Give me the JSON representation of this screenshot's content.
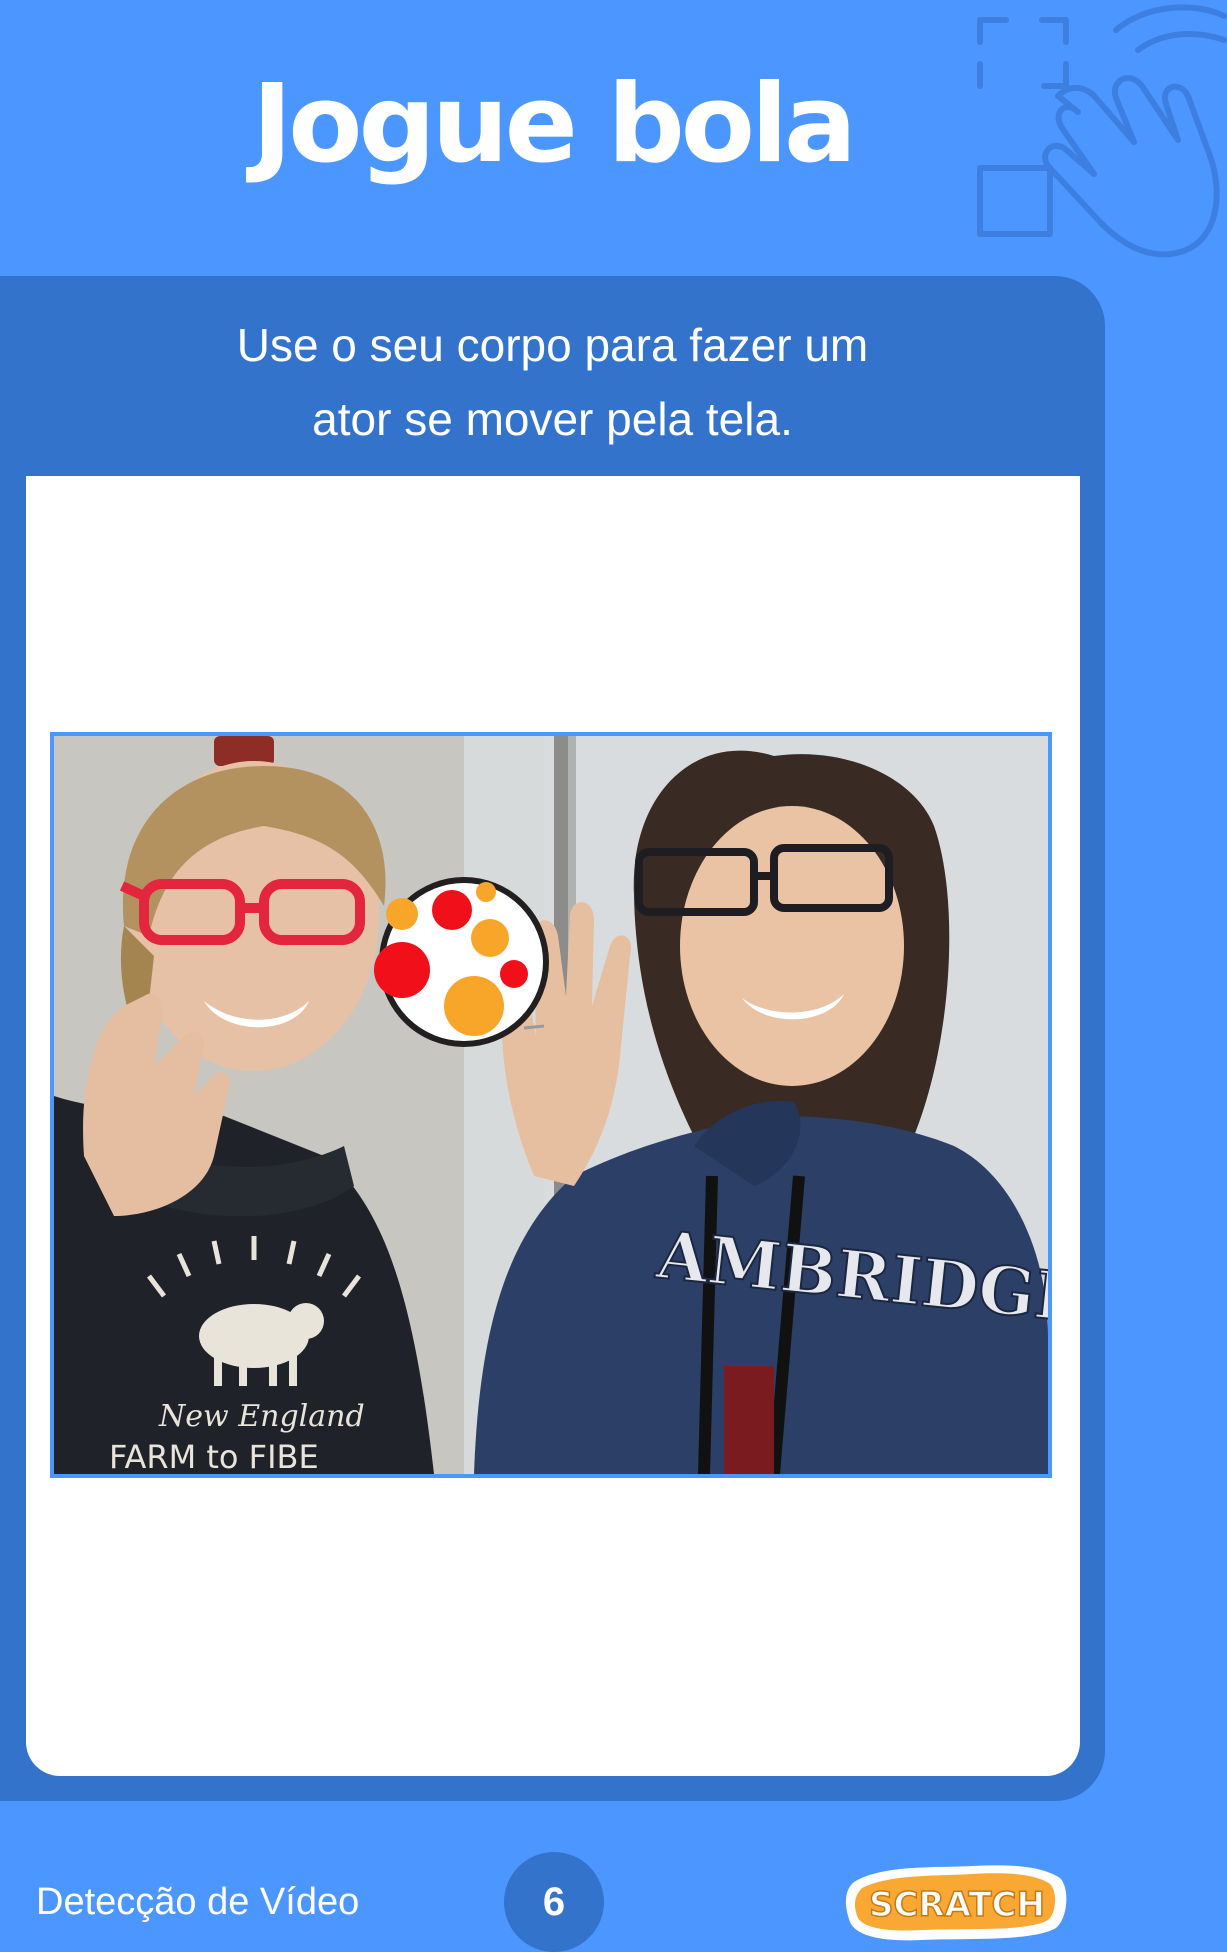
{
  "header": {
    "title": "Jogue bola"
  },
  "card": {
    "instruction_line1": "Use o seu corpo para fazer um",
    "instruction_line2": "ator se mover pela tela."
  },
  "photo": {
    "ball_colors": {
      "red": "#F10F1A",
      "orange": "#F8A62A"
    },
    "shirt_text_line1": "New England",
    "shirt_text_line2": "FARM to FIBE",
    "hoodie_text": "AMBRIDGE"
  },
  "footer": {
    "section_label": "Detecção de Vídeo",
    "page_number": "6",
    "logo_text": "SCRATCH"
  },
  "colors": {
    "background": "#4C97FF",
    "card": "#3373CC",
    "panel": "#FFFFFF",
    "logo_fill": "#F9A834"
  }
}
